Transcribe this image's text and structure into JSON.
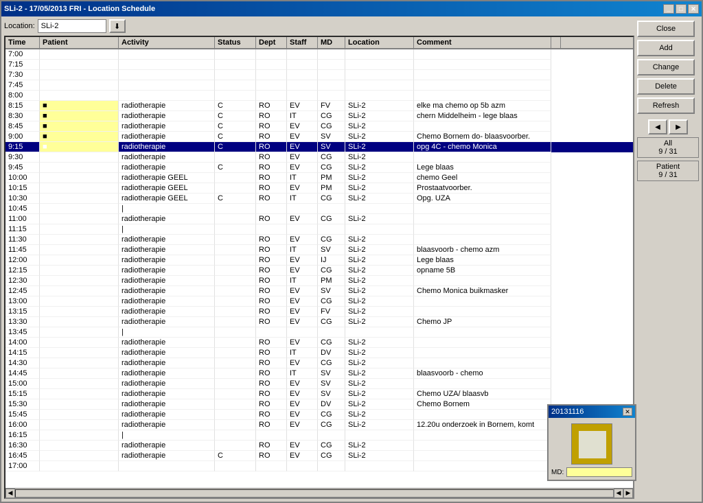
{
  "window": {
    "title": "SLi-2 - 17/05/2013  FRI - Location Schedule",
    "title_icon": "📅"
  },
  "location": {
    "label": "Location:",
    "value": "SLi-2"
  },
  "buttons": {
    "close": "Close",
    "add": "Add",
    "change": "Change",
    "delete": "Delete",
    "refresh": "Refresh"
  },
  "counters": {
    "all_label": "All",
    "all_value": "9 / 31",
    "patient_label": "Patient",
    "patient_value": "9 / 31"
  },
  "columns": [
    "Time",
    "Patient",
    "Activity",
    "Status",
    "Dept",
    "Staff",
    "MD",
    "Location",
    "Comment"
  ],
  "popup": {
    "title": "20131116",
    "md_label": "MD:"
  },
  "rows": [
    {
      "time": "7:00",
      "patient": "",
      "activity": "",
      "status": "",
      "dept": "",
      "staff": "",
      "md": "",
      "location": "",
      "comment": "",
      "selected": false,
      "yellow": false
    },
    {
      "time": "7:15",
      "patient": "",
      "activity": "",
      "status": "",
      "dept": "",
      "staff": "",
      "md": "",
      "location": "",
      "comment": "",
      "selected": false,
      "yellow": false
    },
    {
      "time": "7:30",
      "patient": "",
      "activity": "",
      "status": "",
      "dept": "",
      "staff": "",
      "md": "",
      "location": "",
      "comment": "",
      "selected": false,
      "yellow": false
    },
    {
      "time": "7:45",
      "patient": "",
      "activity": "",
      "status": "",
      "dept": "",
      "staff": "",
      "md": "",
      "location": "",
      "comment": "",
      "selected": false,
      "yellow": false
    },
    {
      "time": "8:00",
      "patient": "",
      "activity": "",
      "status": "",
      "dept": "",
      "staff": "",
      "md": "",
      "location": "",
      "comment": "",
      "selected": false,
      "yellow": false
    },
    {
      "time": "8:15",
      "patient": "■",
      "activity": "radiotherapie",
      "status": "C",
      "dept": "RO",
      "staff": "EV",
      "md": "FV",
      "location": "SLi-2",
      "comment": "elke ma chemo op 5b azm",
      "selected": false,
      "yellow": true
    },
    {
      "time": "8:30",
      "patient": "■",
      "activity": "radiotherapie",
      "status": "C",
      "dept": "RO",
      "staff": "IT",
      "md": "CG",
      "location": "SLi-2",
      "comment": "chern Middelheim - lege blaas",
      "selected": false,
      "yellow": true
    },
    {
      "time": "8:45",
      "patient": "■",
      "activity": "radiotherapie",
      "status": "C",
      "dept": "RO",
      "staff": "EV",
      "md": "CG",
      "location": "SLi-2",
      "comment": "",
      "selected": false,
      "yellow": true
    },
    {
      "time": "9:00",
      "patient": "■",
      "activity": "radiotherapie",
      "status": "C",
      "dept": "RO",
      "staff": "EV",
      "md": "SV",
      "location": "SLi-2",
      "comment": "Chemo Bornem  do- blaasvoorber.",
      "selected": false,
      "yellow": true
    },
    {
      "time": "9:15",
      "patient": "■",
      "activity": "radiotherapie",
      "status": "C",
      "dept": "RO",
      "staff": "EV",
      "md": "SV",
      "location": "SLi-2",
      "comment": "opg 4C - chemo Monica",
      "selected": true,
      "yellow": true
    },
    {
      "time": "9:30",
      "patient": "",
      "activity": "radiotherapie",
      "status": "",
      "dept": "RO",
      "staff": "EV",
      "md": "CG",
      "location": "SLi-2",
      "comment": "",
      "selected": false,
      "yellow": false
    },
    {
      "time": "9:45",
      "patient": "",
      "activity": "radiotherapie",
      "status": "C",
      "dept": "RO",
      "staff": "EV",
      "md": "CG",
      "location": "SLi-2",
      "comment": "Lege blaas",
      "selected": false,
      "yellow": false
    },
    {
      "time": "10:00",
      "patient": "",
      "activity": "radiotherapie GEEL",
      "status": "",
      "dept": "RO",
      "staff": "IT",
      "md": "PM",
      "location": "SLi-2",
      "comment": "chemo Geel",
      "selected": false,
      "yellow": false
    },
    {
      "time": "10:15",
      "patient": "",
      "activity": "radiotherapie GEEL",
      "status": "",
      "dept": "RO",
      "staff": "EV",
      "md": "PM",
      "location": "SLi-2",
      "comment": "Prostaatvoorber.",
      "selected": false,
      "yellow": false
    },
    {
      "time": "10:30",
      "patient": "",
      "activity": "radiotherapie GEEL",
      "status": "C",
      "dept": "RO",
      "staff": "IT",
      "md": "CG",
      "location": "SLi-2",
      "comment": "Opg. UZA",
      "selected": false,
      "yellow": false
    },
    {
      "time": "10:45",
      "patient": "",
      "activity": "|",
      "status": "",
      "dept": "",
      "staff": "",
      "md": "",
      "location": "",
      "comment": "",
      "selected": false,
      "yellow": false
    },
    {
      "time": "11:00",
      "patient": "",
      "activity": "radiotherapie",
      "status": "",
      "dept": "RO",
      "staff": "EV",
      "md": "CG",
      "location": "SLi-2",
      "comment": "",
      "selected": false,
      "yellow": false
    },
    {
      "time": "11:15",
      "patient": "",
      "activity": "|",
      "status": "",
      "dept": "",
      "staff": "",
      "md": "",
      "location": "",
      "comment": "",
      "selected": false,
      "yellow": false
    },
    {
      "time": "11:30",
      "patient": "",
      "activity": "radiotherapie",
      "status": "",
      "dept": "RO",
      "staff": "EV",
      "md": "CG",
      "location": "SLi-2",
      "comment": "",
      "selected": false,
      "yellow": false
    },
    {
      "time": "11:45",
      "patient": "",
      "activity": "radiotherapie",
      "status": "",
      "dept": "RO",
      "staff": "IT",
      "md": "SV",
      "location": "SLi-2",
      "comment": "blaasvoorb - chemo azm",
      "selected": false,
      "yellow": false
    },
    {
      "time": "12:00",
      "patient": "",
      "activity": "radiotherapie",
      "status": "",
      "dept": "RO",
      "staff": "EV",
      "md": "IJ",
      "location": "SLi-2",
      "comment": "Lege blaas",
      "selected": false,
      "yellow": false
    },
    {
      "time": "12:15",
      "patient": "",
      "activity": "radiotherapie",
      "status": "",
      "dept": "RO",
      "staff": "EV",
      "md": "CG",
      "location": "SLi-2",
      "comment": "opname 5B",
      "selected": false,
      "yellow": false
    },
    {
      "time": "12:30",
      "patient": "",
      "activity": "radiotherapie",
      "status": "",
      "dept": "RO",
      "staff": "IT",
      "md": "PM",
      "location": "SLi-2",
      "comment": "",
      "selected": false,
      "yellow": false
    },
    {
      "time": "12:45",
      "patient": "",
      "activity": "radiotherapie",
      "status": "",
      "dept": "RO",
      "staff": "EV",
      "md": "SV",
      "location": "SLi-2",
      "comment": "Chemo Monica buikmasker",
      "selected": false,
      "yellow": false
    },
    {
      "time": "13:00",
      "patient": "",
      "activity": "radiotherapie",
      "status": "",
      "dept": "RO",
      "staff": "EV",
      "md": "CG",
      "location": "SLi-2",
      "comment": "",
      "selected": false,
      "yellow": false
    },
    {
      "time": "13:15",
      "patient": "",
      "activity": "radiotherapie",
      "status": "",
      "dept": "RO",
      "staff": "EV",
      "md": "FV",
      "location": "SLi-2",
      "comment": "",
      "selected": false,
      "yellow": false
    },
    {
      "time": "13:30",
      "patient": "",
      "activity": "radiotherapie",
      "status": "",
      "dept": "RO",
      "staff": "EV",
      "md": "CG",
      "location": "SLi-2",
      "comment": "Chemo JP",
      "selected": false,
      "yellow": false
    },
    {
      "time": "13:45",
      "patient": "",
      "activity": "|",
      "status": "",
      "dept": "",
      "staff": "",
      "md": "",
      "location": "",
      "comment": "",
      "selected": false,
      "yellow": false
    },
    {
      "time": "14:00",
      "patient": "",
      "activity": "radiotherapie",
      "status": "",
      "dept": "RO",
      "staff": "EV",
      "md": "CG",
      "location": "SLi-2",
      "comment": "",
      "selected": false,
      "yellow": false
    },
    {
      "time": "14:15",
      "patient": "",
      "activity": "radiotherapie",
      "status": "",
      "dept": "RO",
      "staff": "IT",
      "md": "DV",
      "location": "SLi-2",
      "comment": "",
      "selected": false,
      "yellow": false
    },
    {
      "time": "14:30",
      "patient": "",
      "activity": "radiotherapie",
      "status": "",
      "dept": "RO",
      "staff": "EV",
      "md": "CG",
      "location": "SLi-2",
      "comment": "",
      "selected": false,
      "yellow": false
    },
    {
      "time": "14:45",
      "patient": "",
      "activity": "radiotherapie",
      "status": "",
      "dept": "RO",
      "staff": "IT",
      "md": "SV",
      "location": "SLi-2",
      "comment": "blaasvoorb - chemo",
      "selected": false,
      "yellow": false
    },
    {
      "time": "15:00",
      "patient": "",
      "activity": "radiotherapie",
      "status": "",
      "dept": "RO",
      "staff": "EV",
      "md": "SV",
      "location": "SLi-2",
      "comment": "",
      "selected": false,
      "yellow": false
    },
    {
      "time": "15:15",
      "patient": "",
      "activity": "radiotherapie",
      "status": "",
      "dept": "RO",
      "staff": "EV",
      "md": "SV",
      "location": "SLi-2",
      "comment": "Chemo UZA/ blaasvb",
      "selected": false,
      "yellow": false
    },
    {
      "time": "15:30",
      "patient": "",
      "activity": "radiotherapie",
      "status": "",
      "dept": "RO",
      "staff": "EV",
      "md": "DV",
      "location": "SLi-2",
      "comment": "Chemo Bornem",
      "selected": false,
      "yellow": false
    },
    {
      "time": "15:45",
      "patient": "",
      "activity": "radiotherapie",
      "status": "",
      "dept": "RO",
      "staff": "EV",
      "md": "CG",
      "location": "SLi-2",
      "comment": "",
      "selected": false,
      "yellow": false
    },
    {
      "time": "16:00",
      "patient": "",
      "activity": "radiotherapie",
      "status": "",
      "dept": "RO",
      "staff": "EV",
      "md": "CG",
      "location": "SLi-2",
      "comment": "12.20u onderzoek in Bornem, komt",
      "selected": false,
      "yellow": false
    },
    {
      "time": "16:15",
      "patient": "",
      "activity": "|",
      "status": "",
      "dept": "",
      "staff": "",
      "md": "",
      "location": "",
      "comment": "",
      "selected": false,
      "yellow": false
    },
    {
      "time": "16:30",
      "patient": "",
      "activity": "radiotherapie",
      "status": "",
      "dept": "RO",
      "staff": "EV",
      "md": "CG",
      "location": "SLi-2",
      "comment": "",
      "selected": false,
      "yellow": false
    },
    {
      "time": "16:45",
      "patient": "",
      "activity": "radiotherapie",
      "status": "C",
      "dept": "RO",
      "staff": "EV",
      "md": "CG",
      "location": "SLi-2",
      "comment": "",
      "selected": false,
      "yellow": false
    },
    {
      "time": "17:00",
      "patient": "",
      "activity": "",
      "status": "",
      "dept": "",
      "staff": "",
      "md": "",
      "location": "",
      "comment": "",
      "selected": false,
      "yellow": false
    }
  ]
}
